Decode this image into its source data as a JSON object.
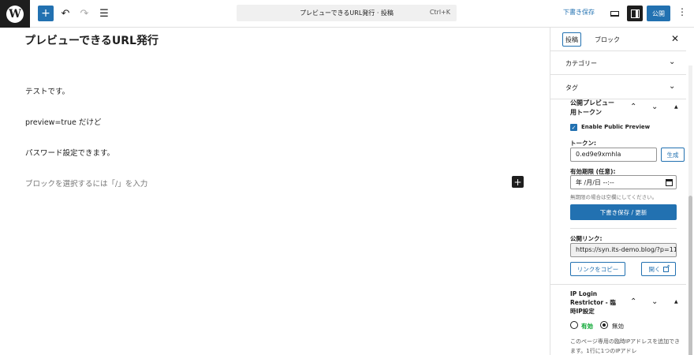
{
  "toolbar": {
    "logo_glyph": "W",
    "inserter_glyph": "+",
    "undo_glyph": "↶",
    "redo_glyph": "↷",
    "listview_glyph": "☰",
    "command_title": "プレビューできるURL発行 · 投稿",
    "command_shortcut": "Ctrl+K",
    "save_draft": "下書き保存",
    "publish": "公開",
    "more_glyph": "⋮"
  },
  "editor": {
    "post_title": "プレビューできるURL発行",
    "paragraphs": [
      "テストです。",
      "preview=true だけど",
      "パスワード設定できます。"
    ],
    "placeholder": "ブロックを選択するには「/」を入力",
    "block_inserter_glyph": "+"
  },
  "sidebar": {
    "tab_post": "投稿",
    "tab_block": "ブロック",
    "close_glyph": "✕",
    "category": "カテゴリー",
    "tag": "タグ",
    "chevron_glyph": "⌄",
    "public_preview": {
      "title": "公開プレビュー用トークン",
      "up_glyph": "⌃",
      "down_glyph": "⌄",
      "tri_glyph": "▲",
      "enable_label": "Enable Public Preview",
      "enable_checked": true,
      "check_glyph": "✓",
      "token_label": "トークン:",
      "token_value": "0.ed9e9xmhla",
      "generate": "生成",
      "expiry_label": "有効期限 (任意):",
      "expiry_value": "年 /月/日 --:--",
      "expiry_hint": "無期限の場合は空欄にしてください。",
      "save_update": "下書き保存 / 更新",
      "link_label": "公開リンク:",
      "link_value": "https://syn.its-demo.blog/?p=11",
      "copy_link": "リンクをコピー",
      "open": "開く"
    },
    "ip_restrictor": {
      "title": "IP Login Restrictor - 臨時IP設定",
      "enabled_label": "有効",
      "disabled_label": "無効",
      "selected": "無効",
      "description": "このページ専用の臨時IPアドレスを追加できます。1行に1つのIPアドレ"
    }
  }
}
